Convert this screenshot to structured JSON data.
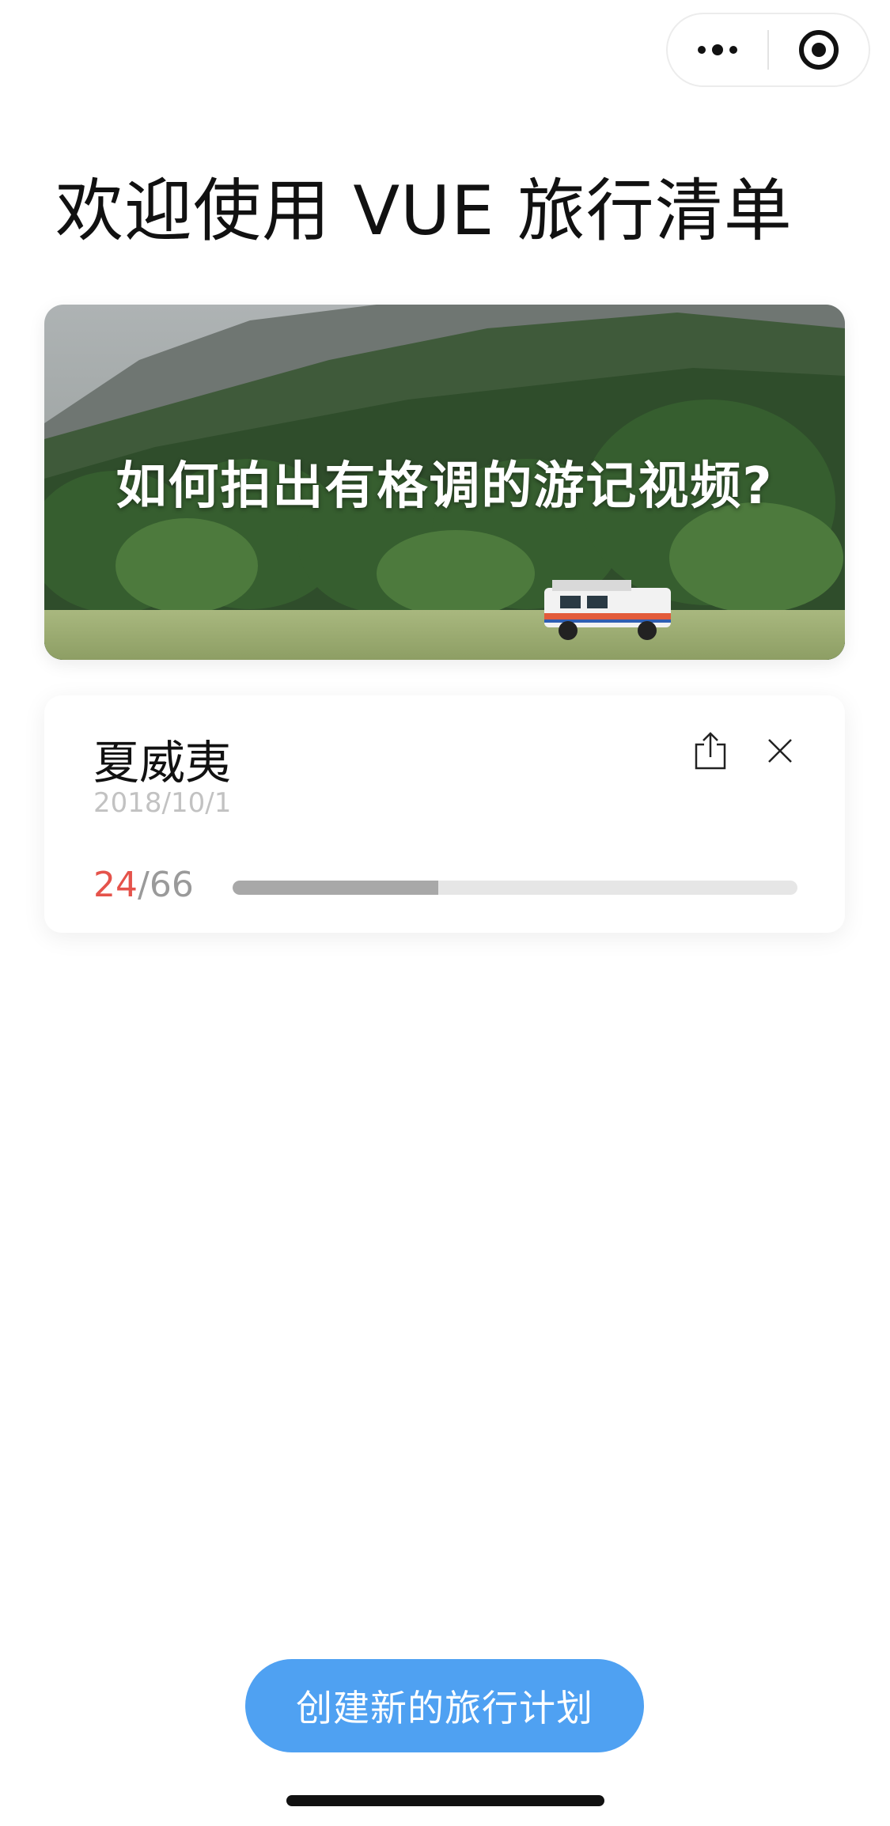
{
  "header": {
    "title": "欢迎使用 VUE 旅行清单",
    "capsule": {
      "menu_icon": "more-dots-icon",
      "close_icon": "target-circle-icon"
    }
  },
  "banner": {
    "text": "如何拍出有格调的游记视频?",
    "image": "forest-field-with-white-jeep-photo"
  },
  "trip": {
    "name": "夏威夷",
    "date": "2018/10/1",
    "checked": "24",
    "separator": "/",
    "total": "66",
    "progress_fraction": 0.364,
    "share_icon": "share-icon",
    "close_icon": "close-icon"
  },
  "footer": {
    "create_button_label": "创建新的旅行计划"
  },
  "colors": {
    "accent_blue": "#4fa1f2",
    "progress_done_red": "#e5534b",
    "progress_track": "#e6e6e6",
    "progress_fill": "#a8a8a8"
  }
}
